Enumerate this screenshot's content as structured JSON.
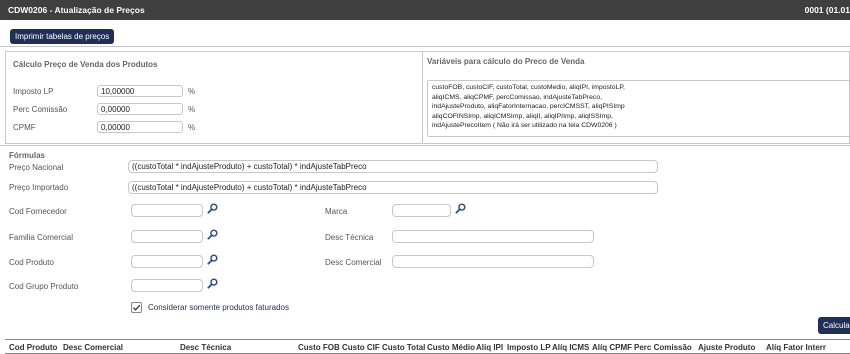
{
  "window": {
    "title": "CDW0206 - Atualização de Preços",
    "version": "0001 (01.01"
  },
  "toolbar": {
    "print_label": "Imprimir tabelas de preços"
  },
  "calc_panel": {
    "title": "Cálculo Preço de Venda dos Produtos",
    "rows": [
      {
        "label": "Imposto LP",
        "value": "10,00000",
        "unit": "%"
      },
      {
        "label": "Perc Comissão",
        "value": "0,00000",
        "unit": "%"
      },
      {
        "label": "CPMF",
        "value": "0,00000",
        "unit": "%"
      }
    ]
  },
  "vars_panel": {
    "title": "Variáveis para cálculo do Preco de Venda",
    "text": "custoFOB, custoCIF, custoTotal, custoMedio, aliqIPI, impostoLP,\naliqICMS, aliqCPMF, percComissao, indAjusteTabPreco,\nindAjusteProduto, aliqFatorInternacao, percICMSST, aliqPISImp\naliqCOFINSImp, aliqICMSImp, aliqII, aliqIPIImp, aliqISSImp,\nindAjustePrecoItem ( Não irá ser utilizado na tela CDW0206 )"
  },
  "formulas": {
    "title": "Fórmulas",
    "preco_nacional": {
      "label": "Preço Nacional",
      "value": "((custoTotal * indAjusteProduto) + custoTotal) * indAjusteTabPreco"
    },
    "preco_importado": {
      "label": "Preço Importado",
      "value": "((custoTotal * indAjusteProduto) + custoTotal) * indAjusteTabPreco"
    }
  },
  "filters": {
    "cod_fornecedor": {
      "label": "Cod Fornecedor",
      "value": ""
    },
    "familia_comercial": {
      "label": "Familia Comercial",
      "value": ""
    },
    "cod_produto": {
      "label": "Cod Produto",
      "value": ""
    },
    "cod_grupo_produto": {
      "label": "Cod Grupo Produto",
      "value": ""
    },
    "marca": {
      "label": "Marca",
      "value": ""
    },
    "desc_tecnica": {
      "label": "Desc Técnica",
      "value": ""
    },
    "desc_comercial": {
      "label": "Desc Comercial",
      "value": ""
    },
    "somente_faturados": {
      "label": "Considerar somente produtos faturados",
      "checked": true
    }
  },
  "actions": {
    "calcular_label": "Calcular"
  },
  "grid": {
    "columns": [
      "Cod Produto",
      "Desc Comercial",
      "Desc Técnica",
      "Custo FOB",
      "Custo CIF",
      "Custo Total",
      "Custo Médio",
      "Alíq IPI",
      "Imposto LP",
      "Alíq ICMS",
      "Alíq CPMF",
      "Perc Comissão",
      "Ajuste Produto",
      "Alíq Fator Interr"
    ]
  },
  "colors": {
    "titlebar_bg": "#3f3f3f",
    "button_bg": "#1f2f57",
    "icon_blue": "#2a4f8f"
  },
  "icons": [
    "search-icon",
    "check-icon"
  ]
}
